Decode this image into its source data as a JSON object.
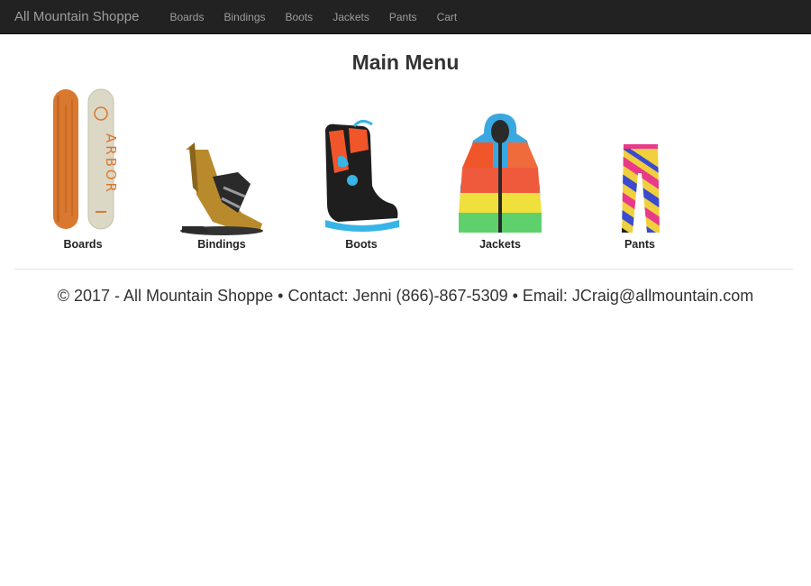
{
  "navbar": {
    "brand": "All Mountain Shoppe",
    "links": [
      "Boards",
      "Bindings",
      "Boots",
      "Jackets",
      "Pants",
      "Cart"
    ]
  },
  "main": {
    "title": "Main Menu",
    "products": [
      {
        "label": "Boards",
        "icon": "snowboard-image"
      },
      {
        "label": "Bindings",
        "icon": "binding-image"
      },
      {
        "label": "Boots",
        "icon": "boot-image"
      },
      {
        "label": "Jackets",
        "icon": "jacket-image"
      },
      {
        "label": "Pants",
        "icon": "pants-image"
      }
    ]
  },
  "footer": {
    "text": "© 2017 - All Mountain Shoppe • Contact: Jenni (866)-867-5309 • Email: JCraig@allmountain.com"
  },
  "colors": {
    "navbar_bg": "#222222",
    "nav_text": "#9d9d9d",
    "board_wood": "#d9782f",
    "board_cream": "#dcd8c6",
    "boot_orange": "#f0562a",
    "boot_blue": "#39b4e6"
  }
}
